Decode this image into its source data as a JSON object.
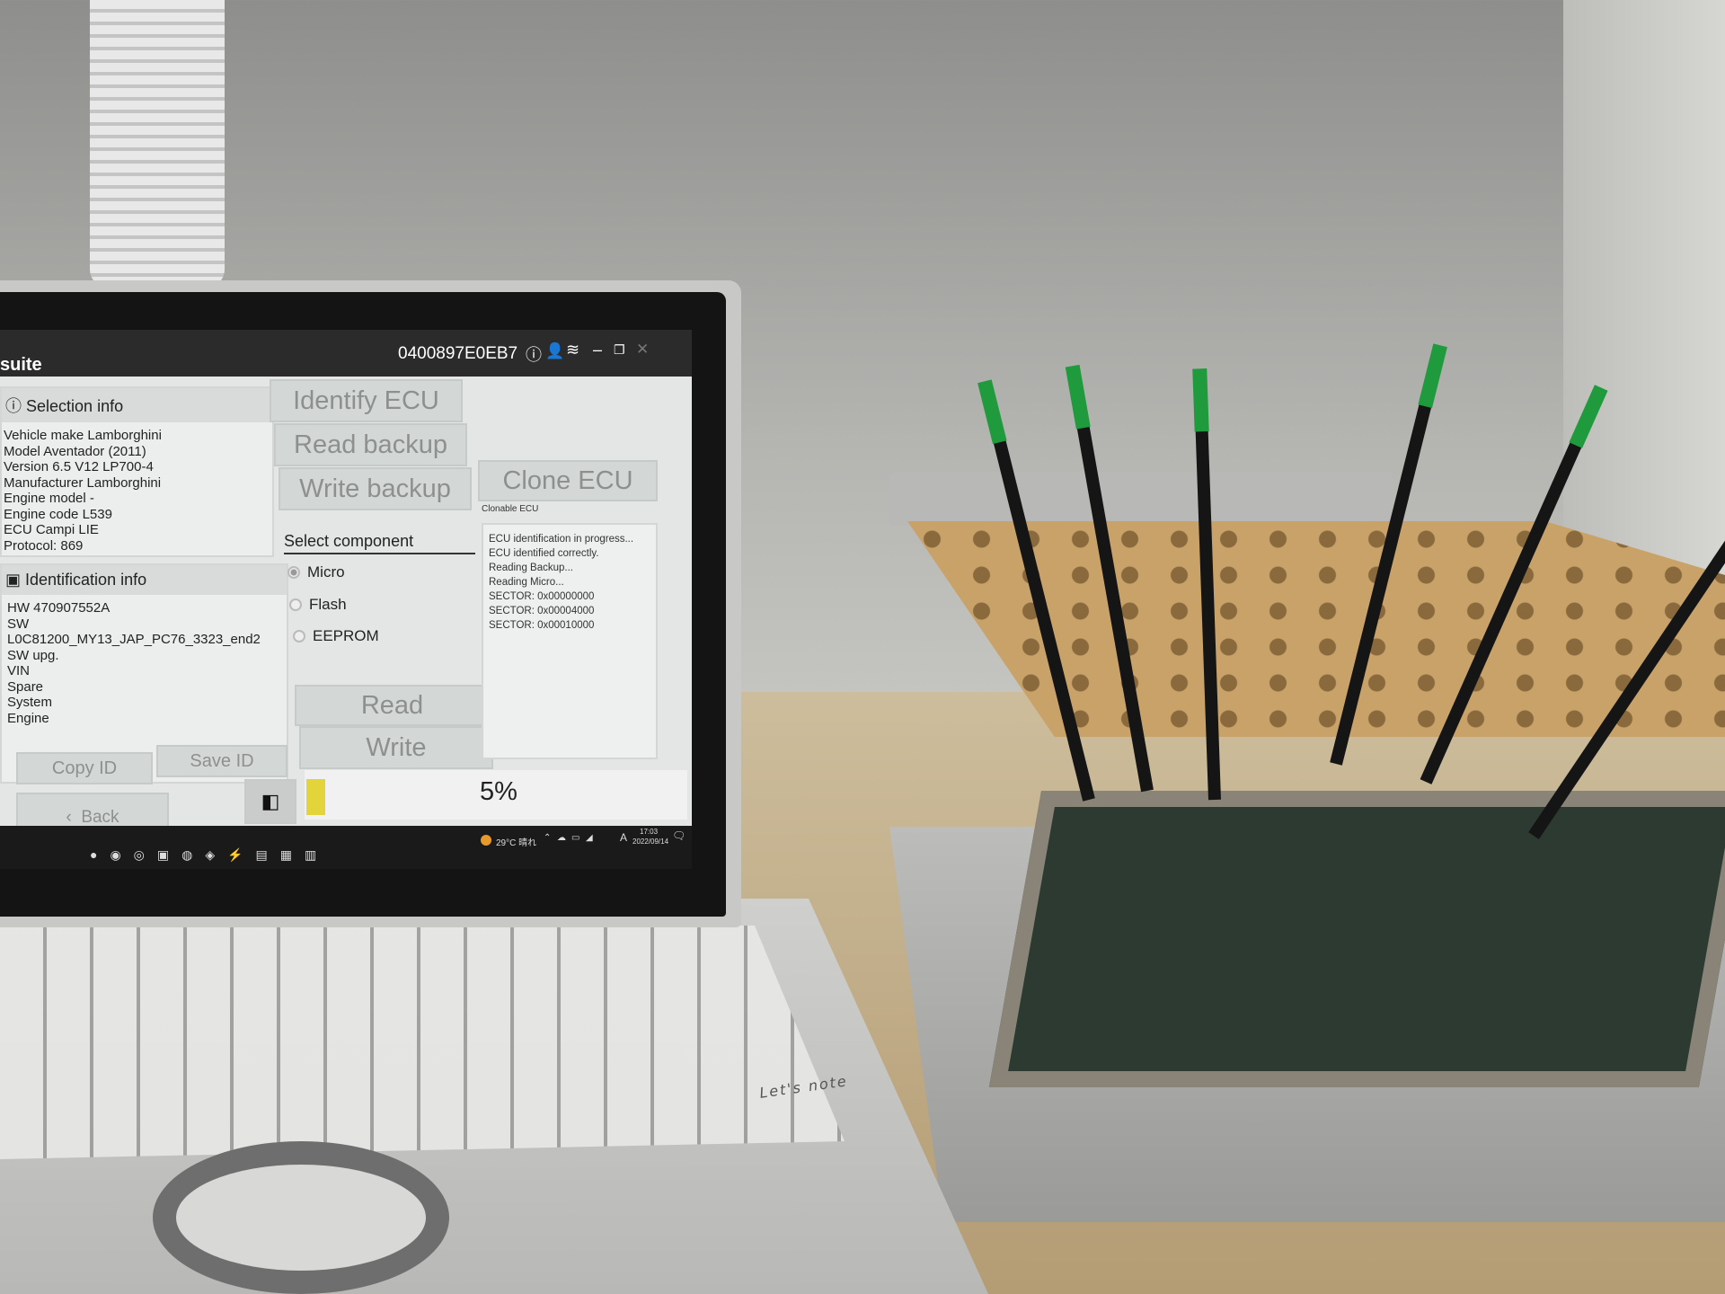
{
  "app": {
    "title": "suite",
    "device_id": "0400897E0EB7",
    "title_icons": [
      "info-icon",
      "user-icon",
      "wifi-icon",
      "minimize-icon",
      "restore-icon",
      "close-icon"
    ]
  },
  "selection_info": {
    "heading": "Selection info",
    "lines": [
      "Vehicle make Lamborghini",
      "Model Aventador (2011)",
      "Version 6.5 V12 LP700-4",
      "Manufacturer Lamborghini",
      "Engine model -",
      "Engine code L539",
      "ECU Campi LIE",
      "Protocol: 869"
    ]
  },
  "identification_info": {
    "heading": "Identification info",
    "lines": [
      "HW 470907552A",
      "SW L0C81200_MY13_JAP_PC76_3323_end2",
      "SW upg.",
      "VIN",
      "Spare",
      "System",
      "Engine"
    ]
  },
  "buttons": {
    "identify": "Identify ECU",
    "read_backup": "Read backup",
    "write_backup": "Write backup",
    "clone": "Clone ECU",
    "clone_caption": "Clonable ECU",
    "read": "Read",
    "write": "Write",
    "copy_id": "Copy ID",
    "save_id": "Save ID",
    "back": "Back"
  },
  "component": {
    "heading": "Select component",
    "options": [
      {
        "label": "Micro",
        "selected": true
      },
      {
        "label": "Flash",
        "selected": false
      },
      {
        "label": "EEPROM",
        "selected": false
      }
    ]
  },
  "log": [
    "ECU identification in progress...",
    "ECU identified correctly.",
    "Reading Backup...",
    "Reading Micro...",
    "SECTOR: 0x00000000",
    "SECTOR: 0x00004000",
    "SECTOR: 0x00010000"
  ],
  "progress": {
    "percent": 5,
    "label": "5%",
    "color": "#e2d43a"
  },
  "taskbar": {
    "weather": "29°C 晴れ",
    "time": "17:03",
    "date": "2022/09/14",
    "ime": "A"
  },
  "laptop": {
    "brand": "Let's note"
  }
}
